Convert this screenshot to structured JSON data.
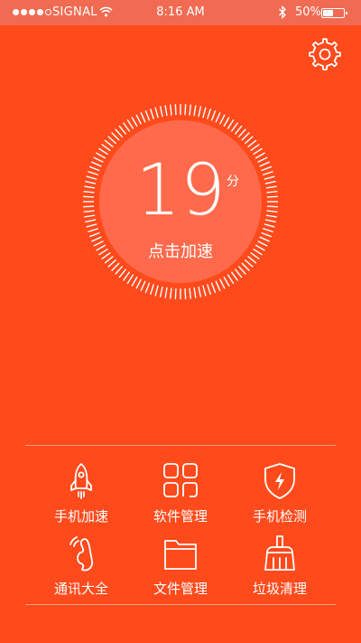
{
  "status_bar": {
    "carrier": "SIGNAL",
    "time": "8:16 AM",
    "battery": "50%",
    "battery_level": 0.5
  },
  "score": {
    "value": "19",
    "unit": "分",
    "action": "点击加速"
  },
  "tools": [
    {
      "label": "手机加速",
      "icon": "rocket-icon"
    },
    {
      "label": "软件管理",
      "icon": "app-grid-icon"
    },
    {
      "label": "手机检测",
      "icon": "shield-icon"
    },
    {
      "label": "通讯大全",
      "icon": "phone-icon"
    },
    {
      "label": "文件管理",
      "icon": "folder-icon"
    },
    {
      "label": "垃圾清理",
      "icon": "broom-icon"
    }
  ],
  "colors": {
    "background": "#FF4A1C",
    "status_bar": "#F06B52",
    "circle": "#FF6A4C",
    "foreground": "#FFFFFF"
  }
}
